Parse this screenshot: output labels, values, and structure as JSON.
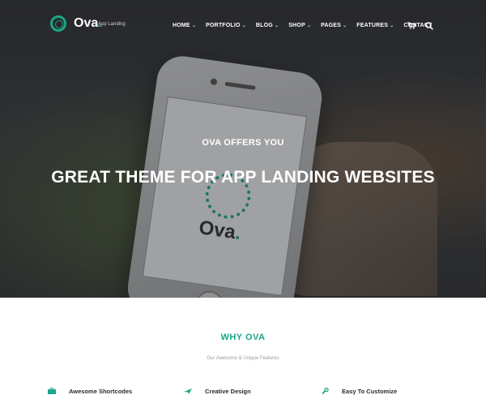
{
  "brand": {
    "name": "Ova",
    "dot": ".",
    "tagline": "App Landing",
    "accent_color": "#19a687"
  },
  "nav": {
    "items": [
      {
        "label": "HOME",
        "has_dropdown": true
      },
      {
        "label": "PORTFOLIO",
        "has_dropdown": true
      },
      {
        "label": "BLOG",
        "has_dropdown": true
      },
      {
        "label": "SHOP",
        "has_dropdown": true
      },
      {
        "label": "PAGES",
        "has_dropdown": true
      },
      {
        "label": "FEATURES",
        "has_dropdown": true
      },
      {
        "label": "CONTACT",
        "has_dropdown": false
      }
    ],
    "dropdown_glyph": "⌄",
    "icons": [
      "cart-icon",
      "search-icon"
    ]
  },
  "hero": {
    "kicker": "OVA OFFERS YOU",
    "title": "GREAT THEME FOR APP LANDING WEBSITES",
    "phone_logo": "Ova",
    "phone_logo_dot": "."
  },
  "why": {
    "title": "WHY OVA",
    "subtitle": "Our Awesome & Unique Features",
    "features": [
      {
        "label": "Awesome Shortcodes",
        "icon": "briefcase-icon"
      },
      {
        "label": "Creative Design",
        "icon": "plane-icon"
      },
      {
        "label": "Easy To Customize",
        "icon": "wrench-icon"
      }
    ]
  }
}
